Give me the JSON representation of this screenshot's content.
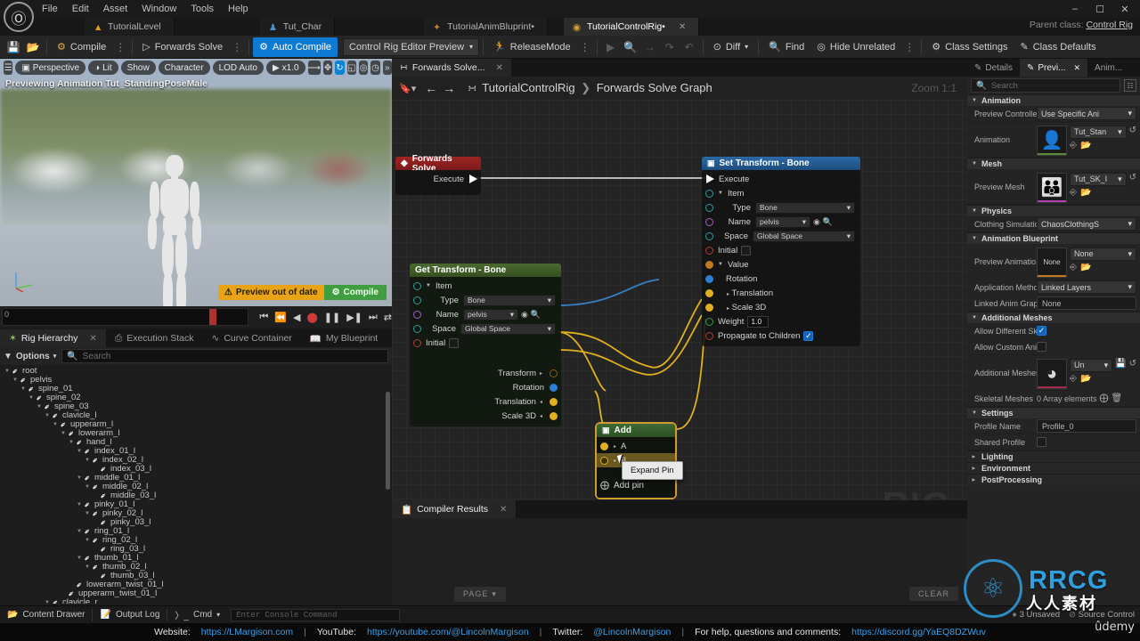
{
  "menu": {
    "items": [
      "File",
      "Edit",
      "Asset",
      "Window",
      "Tools",
      "Help"
    ],
    "logo_icon": "unreal-engine-logo",
    "window_controls": [
      "minimize",
      "restore",
      "close"
    ]
  },
  "asset_tabs": [
    {
      "label": "TutorialLevel",
      "icon": "level-icon",
      "active": false
    },
    {
      "label": "Tut_Char",
      "icon": "character-icon",
      "active": false
    },
    {
      "label": "TutorialAnimBluprint*",
      "icon": "anim-bp-icon",
      "active": false
    },
    {
      "label": "TutorialControlRig*",
      "icon": "control-rig-icon",
      "active": true
    }
  ],
  "asset_tabs_text": {
    "t1": "TutorialLevel",
    "t2": "Tut_Char",
    "t3": "TutorialAnimBluprint•",
    "t4": "TutorialControlRig•"
  },
  "parent_class": {
    "label": "Parent class:",
    "value": "Control Rig"
  },
  "toolbar": {
    "save_icon": "save-icon",
    "browse_icon": "browse-content-icon",
    "compile_label": "Compile",
    "forwards_solve_label": "Forwards Solve",
    "auto_compile_label": "Auto Compile",
    "preview_select": "Control Rig Editor Preview",
    "release_mode_label": "ReleaseMode",
    "play_icon": "play-icon",
    "search_icon": "search-icon",
    "step_into_icon": "step-into-icon",
    "step_over_icon": "step-over-icon",
    "step_out_icon": "step-out-icon",
    "diff_label": "Diff",
    "find_label": "Find",
    "hide_unrelated_label": "Hide Unrelated",
    "class_settings_label": "Class Settings",
    "class_defaults_label": "Class Defaults"
  },
  "viewport": {
    "menu_icon": "hamburger-icon",
    "perspective": "Perspective",
    "lit": "Lit",
    "show": "Show",
    "character": "Character",
    "lod": "LOD Auto",
    "speed": "x1.0",
    "status_label": "Previewing Animation Tut_StandingPoseMale",
    "warning_banner": "Preview out of date",
    "compile_banner": "Compile",
    "gizmo_icons": [
      "select-icon",
      "move-icon",
      "rotate-icon",
      "scale-icon",
      "snap-icon",
      "camera-icon",
      "more-icon"
    ],
    "timeline": {
      "start": "0",
      "controls": [
        "skip-back-icon",
        "step-back-icon",
        "play-reverse-icon",
        "record-icon",
        "pause-icon",
        "play-forward-icon",
        "step-forward-icon",
        "loop-icon"
      ]
    }
  },
  "hierarchy": {
    "tabs": [
      {
        "label": "Rig Hierarchy",
        "icon": "rig-hierarchy-icon",
        "active": true
      },
      {
        "label": "Execution Stack",
        "icon": "execution-stack-icon",
        "active": false
      },
      {
        "label": "Curve Container",
        "icon": "curve-container-icon",
        "active": false
      },
      {
        "label": "My Blueprint",
        "icon": "my-blueprint-icon",
        "active": false
      }
    ],
    "options_label": "Options",
    "search_placeholder": "Search",
    "tree": [
      {
        "depth": 0,
        "label": "root",
        "expandable": true
      },
      {
        "depth": 1,
        "label": "pelvis",
        "expandable": true
      },
      {
        "depth": 2,
        "label": "spine_01",
        "expandable": true
      },
      {
        "depth": 3,
        "label": "spine_02",
        "expandable": true
      },
      {
        "depth": 4,
        "label": "spine_03",
        "expandable": true
      },
      {
        "depth": 5,
        "label": "clavicle_l",
        "expandable": true
      },
      {
        "depth": 6,
        "label": "upperarm_l",
        "expandable": true
      },
      {
        "depth": 7,
        "label": "lowerarm_l",
        "expandable": true
      },
      {
        "depth": 8,
        "label": "hand_l",
        "expandable": true
      },
      {
        "depth": 9,
        "label": "index_01_l",
        "expandable": true
      },
      {
        "depth": 10,
        "label": "index_02_l",
        "expandable": true
      },
      {
        "depth": 11,
        "label": "index_03_l",
        "expandable": false
      },
      {
        "depth": 9,
        "label": "middle_01_l",
        "expandable": true
      },
      {
        "depth": 10,
        "label": "middle_02_l",
        "expandable": true
      },
      {
        "depth": 11,
        "label": "middle_03_l",
        "expandable": false
      },
      {
        "depth": 9,
        "label": "pinky_01_l",
        "expandable": true
      },
      {
        "depth": 10,
        "label": "pinky_02_l",
        "expandable": true
      },
      {
        "depth": 11,
        "label": "pinky_03_l",
        "expandable": false
      },
      {
        "depth": 9,
        "label": "ring_01_l",
        "expandable": true
      },
      {
        "depth": 10,
        "label": "ring_02_l",
        "expandable": true
      },
      {
        "depth": 11,
        "label": "ring_03_l",
        "expandable": false
      },
      {
        "depth": 9,
        "label": "thumb_01_l",
        "expandable": true
      },
      {
        "depth": 10,
        "label": "thumb_02_l",
        "expandable": true
      },
      {
        "depth": 11,
        "label": "thumb_03_l",
        "expandable": false
      },
      {
        "depth": 8,
        "label": "lowerarm_twist_01_l",
        "expandable": false
      },
      {
        "depth": 7,
        "label": "upperarm_twist_01_l",
        "expandable": false
      },
      {
        "depth": 5,
        "label": "clavicle_r",
        "expandable": true
      }
    ]
  },
  "graph": {
    "tab_label": "Forwards Solve...",
    "tab_icon": "graph-icon",
    "back_icon": "back-arrow-icon",
    "forward_icon": "forward-arrow-icon",
    "breadcrumb_root": "TutorialControlRig",
    "breadcrumb_leaf": "Forwards Solve Graph",
    "zoom_label": "Zoom 1:1",
    "watermark": "RIG",
    "nodes": {
      "forwards_solve": {
        "title": "Forwards Solve",
        "exec_label": "Execute"
      },
      "set_transform": {
        "title": "Set Transform - Bone",
        "exec_label": "Execute",
        "item_label": "Item",
        "type_label": "Type",
        "type_value": "Bone",
        "name_label": "Name",
        "name_value": "pelvis",
        "space_label": "Space",
        "space_value": "Global Space",
        "initial_label": "Initial",
        "value_label": "Value",
        "rotation_label": "Rotation",
        "translation_label": "Translation",
        "scale_label": "Scale 3D",
        "weight_label": "Weight",
        "weight_value": "1.0",
        "propagate_label": "Propagate to Children",
        "propagate_checked": true
      },
      "get_transform": {
        "title": "Get Transform - Bone",
        "item_label": "Item",
        "type_label": "Type",
        "type_value": "Bone",
        "name_label": "Name",
        "name_value": "pelvis",
        "space_label": "Space",
        "space_value": "Global Space",
        "initial_label": "Initial",
        "out_transform": "Transform",
        "out_rotation": "Rotation",
        "out_translation": "Translation",
        "out_scale": "Scale 3D"
      },
      "add": {
        "title": "Add",
        "pin_a": "A",
        "pin_b": "B",
        "add_pin_label": "Add pin",
        "tooltip": "Expand Pin"
      }
    }
  },
  "compiler": {
    "tab_label": "Compiler Results",
    "tab_icon": "compiler-icon",
    "page_button": "PAGE",
    "clear_button": "CLEAR"
  },
  "details": {
    "tabs": [
      {
        "label": "Details",
        "icon": "details-icon",
        "active": false
      },
      {
        "label": "Previ...",
        "icon": "preview-scene-icon",
        "active": true
      },
      {
        "label": "Anim...",
        "icon": "anim-icon",
        "active": false
      }
    ],
    "search_placeholder": "Search",
    "grid_icon": "grid-view-icon",
    "sections": [
      {
        "name": "Animation",
        "rows": [
          {
            "label": "Preview Controller",
            "type": "combo",
            "value": "Use Specific Ani"
          },
          {
            "label": "Animation",
            "type": "asset",
            "value": "Tut_Stan",
            "thumb": "character-thumb",
            "accent": "#5a8a3a"
          }
        ]
      },
      {
        "name": "Mesh",
        "rows": [
          {
            "label": "Preview Mesh",
            "type": "asset",
            "value": "Tut_SK_I",
            "thumb": "mesh-thumb",
            "accent": "#b040b0"
          }
        ]
      },
      {
        "name": "Physics",
        "rows": [
          {
            "label": "Clothing Simulation I",
            "type": "combo",
            "value": "ChaosClothingS"
          }
        ]
      },
      {
        "name": "Animation Blueprint",
        "rows": [
          {
            "label": "Preview Animatio...",
            "type": "asset",
            "value": "None",
            "thumb": "None",
            "accent": "#c07a20"
          },
          {
            "label": "Application Method",
            "type": "combo",
            "value": "Linked Layers"
          },
          {
            "label": "Linked Anim Grap...",
            "type": "text",
            "value": "None"
          }
        ]
      },
      {
        "name": "Additional Meshes",
        "rows": [
          {
            "label": "Allow Different Skel",
            "type": "check",
            "checked": true
          },
          {
            "label": "Allow Custom Anim",
            "type": "check",
            "checked": false
          },
          {
            "label": "Additional Meshes",
            "type": "asset",
            "value": "Un",
            "thumb": "pie-thumb",
            "accent": "#a3284a"
          },
          {
            "label": "Skeletal Meshes",
            "type": "array",
            "value": "0 Array elements"
          }
        ]
      },
      {
        "name": "Settings",
        "rows": [
          {
            "label": "Profile Name",
            "type": "text",
            "value": "Profile_0"
          },
          {
            "label": "Shared Profile",
            "type": "check",
            "checked": false
          }
        ]
      }
    ],
    "collapsed": [
      "Lighting",
      "Environment",
      "PostProcessing"
    ]
  },
  "statusbar": {
    "content_drawer": "Content Drawer",
    "output_log": "Output Log",
    "cmd_label": "Cmd",
    "console_placeholder": "Enter Console Command",
    "unsaved": "3 Unsaved",
    "source_control": "Source Control"
  },
  "footer": {
    "website_label": "Website:",
    "website_url": "https://LMargison.com",
    "youtube_label": "YouTube:",
    "youtube_url": "https://youtube.com/@LincolnMargison",
    "twitter_label": "Twitter:",
    "twitter_handle": "@LincolnMargison",
    "help_label": "For help, questions and comments:",
    "discord_url": "https://discord.gg/YaEQ8DZWuv"
  },
  "watermarks": {
    "rrcg": "RRCG",
    "rrcg_cn": "人人素材",
    "udemy": "ûdemy"
  }
}
